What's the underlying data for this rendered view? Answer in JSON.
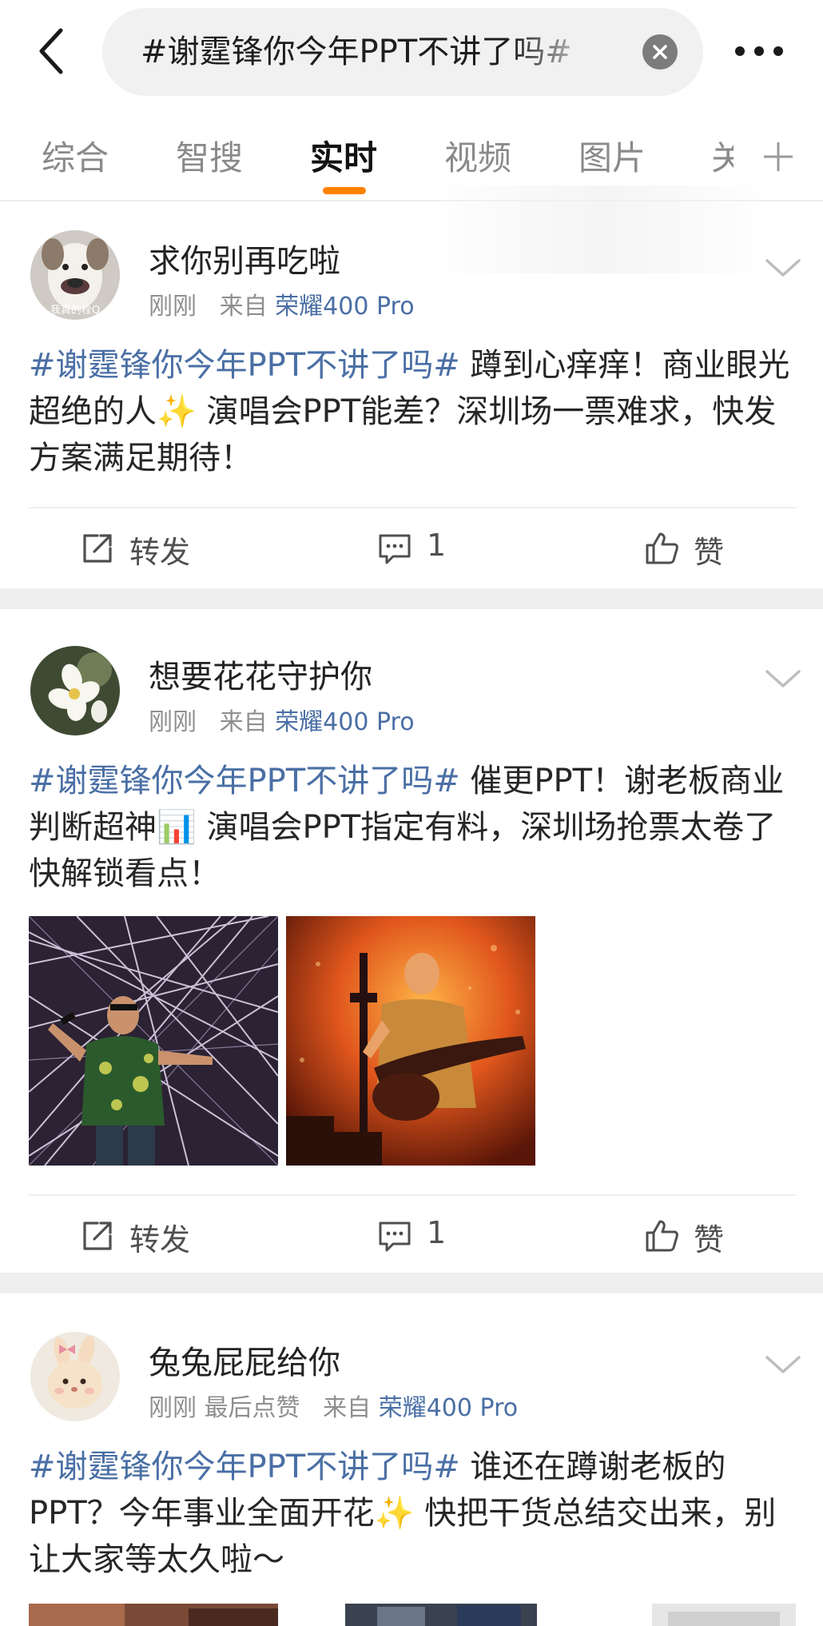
{
  "search": {
    "query": "#谢霆锋你今年PPT不讲了吗#"
  },
  "tabs": [
    {
      "label": "综合"
    },
    {
      "label": "智搜"
    },
    {
      "label": "实时"
    },
    {
      "label": "视频"
    },
    {
      "label": "图片"
    },
    {
      "label": "关"
    }
  ],
  "active_tab": "实时",
  "accent_color": "#ff8200",
  "link_color": "#4a6fa5",
  "icons": {
    "back": "back-arrow-icon",
    "clear": "clear-icon",
    "more": "more-dots-icon",
    "add_tab": "plus-icon",
    "menu": "chevron-down-icon",
    "repost": "repost-icon",
    "comment": "comment-icon",
    "like": "like-icon"
  },
  "posts": [
    {
      "author": "求你别再吃啦",
      "avatar_caption": "我真的栓Q",
      "time": "刚刚",
      "source_prefix": "来自",
      "source": "荣耀400 Pro",
      "topic": "#谢霆锋你今年PPT不讲了吗#",
      "text": " 蹲到心痒痒！商业眼光超绝的人✨ 演唱会PPT能差？深圳场一票难求，快发方案满足期待！",
      "actions": {
        "repost": "转发",
        "comment": "1",
        "like": "赞"
      }
    },
    {
      "author": "想要花花守护你",
      "time": "刚刚",
      "source_prefix": "来自",
      "source": "荣耀400 Pro",
      "topic": "#谢霆锋你今年PPT不讲了吗#",
      "text": " 催更PPT！谢老板商业判断超神📊 演唱会PPT指定有料，深圳场抢票太卷了快解锁看点！",
      "actions": {
        "repost": "转发",
        "comment": "1",
        "like": "赞"
      }
    },
    {
      "author": "兔兔屁屁给你",
      "time": "刚刚",
      "extra": "最后点赞",
      "source_prefix": "来自",
      "source": "荣耀400 Pro",
      "topic": "#谢霆锋你今年PPT不讲了吗#",
      "text": " 谁还在蹲谢老板的PPT？今年事业全面开花✨ 快把干货总结交出来，别让大家等太久啦～"
    }
  ]
}
